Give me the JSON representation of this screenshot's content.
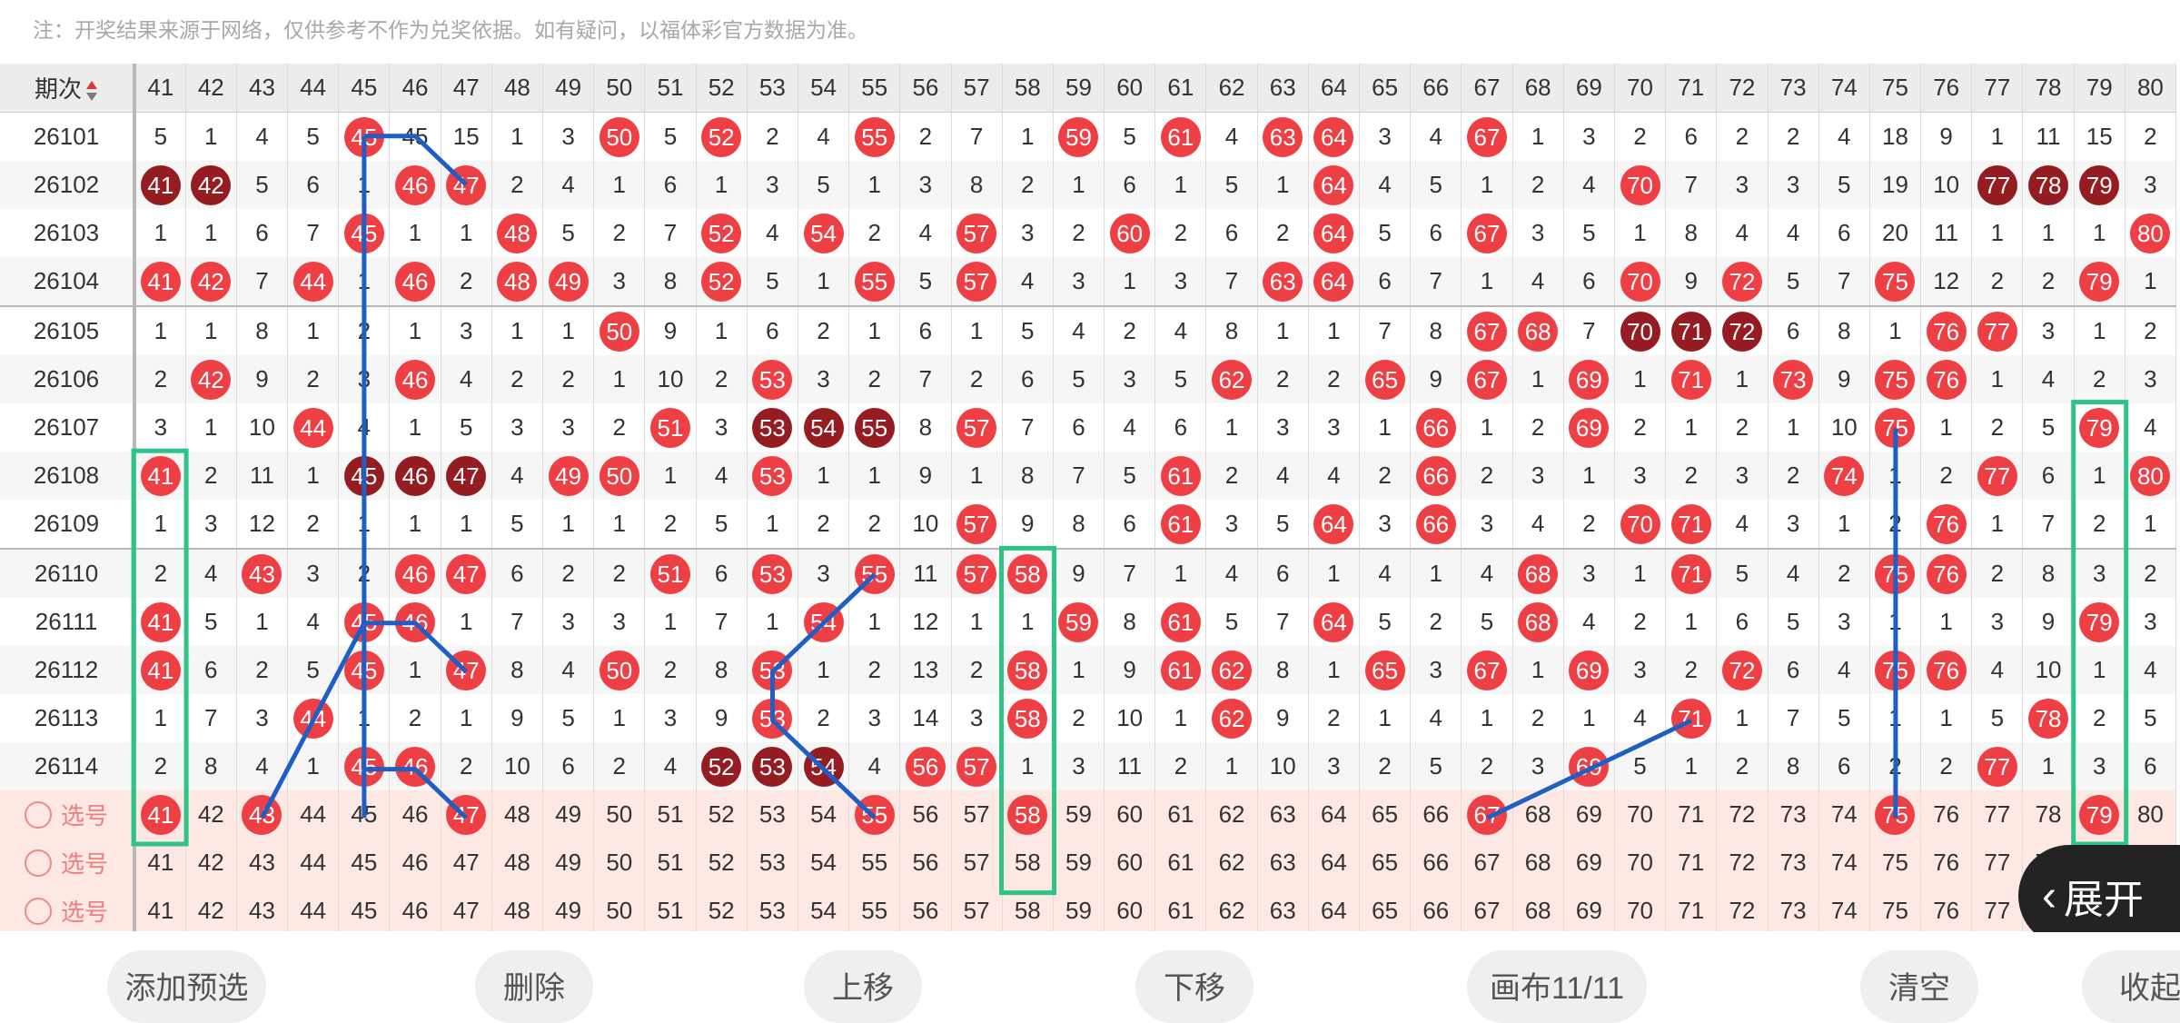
{
  "notice": "注：开奖结果来源于网络，仅供参考不作为兑奖依据。如有疑问，以福体彩官方数据为准。",
  "header": {
    "period_label": "期次",
    "numbers": [
      41,
      42,
      43,
      44,
      45,
      46,
      47,
      48,
      49,
      50,
      51,
      52,
      53,
      54,
      55,
      56,
      57,
      58,
      59,
      60,
      61,
      62,
      63,
      64,
      65,
      66,
      67,
      68,
      69,
      70,
      71,
      72,
      73,
      74,
      75,
      76,
      77,
      78,
      79,
      80
    ]
  },
  "rows": [
    {
      "period": "26101",
      "cells": [
        "5",
        "1",
        "4",
        "5",
        "45",
        "45",
        "15",
        "1",
        "3",
        "50",
        "5",
        "52",
        "2",
        "4",
        "55",
        "2",
        "7",
        "1",
        "59",
        "5",
        "61",
        "4",
        "63",
        "64",
        "3",
        "4",
        "67",
        "1",
        "3",
        "2",
        "6",
        "2",
        "2",
        "4",
        "18",
        "9",
        "1",
        "11",
        "15",
        "2"
      ]
    },
    {
      "period": "26102",
      "cells": [
        "41",
        "42",
        "5",
        "6",
        "1",
        "46",
        "47",
        "2",
        "4",
        "1",
        "6",
        "1",
        "3",
        "5",
        "1",
        "3",
        "8",
        "2",
        "1",
        "6",
        "1",
        "5",
        "1",
        "64",
        "4",
        "5",
        "1",
        "2",
        "4",
        "70",
        "7",
        "3",
        "3",
        "5",
        "19",
        "10",
        "77",
        "78",
        "79",
        "3"
      ]
    },
    {
      "period": "26103",
      "cells": [
        "1",
        "1",
        "6",
        "7",
        "45",
        "1",
        "1",
        "48",
        "5",
        "2",
        "7",
        "52",
        "4",
        "54",
        "2",
        "4",
        "57",
        "3",
        "2",
        "60",
        "2",
        "6",
        "2",
        "64",
        "5",
        "6",
        "67",
        "3",
        "5",
        "1",
        "8",
        "4",
        "4",
        "6",
        "20",
        "11",
        "1",
        "1",
        "1",
        "80"
      ]
    },
    {
      "period": "26104",
      "cells": [
        "41",
        "42",
        "7",
        "44",
        "1",
        "46",
        "2",
        "48",
        "49",
        "3",
        "8",
        "52",
        "5",
        "1",
        "55",
        "5",
        "57",
        "4",
        "3",
        "1",
        "3",
        "7",
        "63",
        "64",
        "6",
        "7",
        "1",
        "4",
        "6",
        "70",
        "9",
        "72",
        "5",
        "7",
        "75",
        "12",
        "2",
        "2",
        "79",
        "1"
      ]
    },
    {
      "period": "26105",
      "cells": [
        "1",
        "1",
        "8",
        "1",
        "2",
        "1",
        "3",
        "1",
        "1",
        "50",
        "9",
        "1",
        "6",
        "2",
        "1",
        "6",
        "1",
        "5",
        "4",
        "2",
        "4",
        "8",
        "1",
        "1",
        "7",
        "8",
        "67",
        "68",
        "7",
        "70",
        "71",
        "72",
        "6",
        "8",
        "1",
        "76",
        "77",
        "3",
        "1",
        "2"
      ]
    },
    {
      "period": "26106",
      "cells": [
        "2",
        "42",
        "9",
        "2",
        "3",
        "46",
        "4",
        "2",
        "2",
        "1",
        "10",
        "2",
        "53",
        "3",
        "2",
        "7",
        "2",
        "6",
        "5",
        "3",
        "5",
        "62",
        "2",
        "2",
        "65",
        "9",
        "67",
        "1",
        "69",
        "1",
        "71",
        "1",
        "73",
        "9",
        "75",
        "76",
        "1",
        "4",
        "2",
        "3"
      ]
    },
    {
      "period": "26107",
      "cells": [
        "3",
        "1",
        "10",
        "44",
        "4",
        "1",
        "5",
        "3",
        "3",
        "2",
        "51",
        "3",
        "53",
        "54",
        "55",
        "8",
        "57",
        "7",
        "6",
        "4",
        "6",
        "1",
        "3",
        "3",
        "1",
        "66",
        "1",
        "2",
        "69",
        "2",
        "1",
        "2",
        "1",
        "10",
        "75",
        "1",
        "2",
        "5",
        "79",
        "4"
      ]
    },
    {
      "period": "26108",
      "cells": [
        "41",
        "2",
        "11",
        "1",
        "45",
        "46",
        "47",
        "4",
        "49",
        "50",
        "1",
        "4",
        "53",
        "1",
        "1",
        "9",
        "1",
        "8",
        "7",
        "5",
        "61",
        "2",
        "4",
        "4",
        "2",
        "66",
        "2",
        "3",
        "1",
        "3",
        "2",
        "3",
        "2",
        "74",
        "1",
        "2",
        "77",
        "6",
        "1",
        "80"
      ]
    },
    {
      "period": "26109",
      "cells": [
        "1",
        "3",
        "12",
        "2",
        "1",
        "1",
        "1",
        "5",
        "1",
        "1",
        "2",
        "5",
        "1",
        "2",
        "2",
        "10",
        "57",
        "9",
        "8",
        "6",
        "61",
        "3",
        "5",
        "64",
        "3",
        "66",
        "3",
        "4",
        "2",
        "70",
        "71",
        "4",
        "3",
        "1",
        "2",
        "76",
        "1",
        "7",
        "2",
        "1"
      ]
    },
    {
      "period": "26110",
      "cells": [
        "2",
        "4",
        "43",
        "3",
        "2",
        "46",
        "47",
        "6",
        "2",
        "2",
        "51",
        "6",
        "53",
        "3",
        "55",
        "11",
        "57",
        "58",
        "9",
        "7",
        "1",
        "4",
        "6",
        "1",
        "4",
        "1",
        "4",
        "68",
        "3",
        "1",
        "71",
        "5",
        "4",
        "2",
        "75",
        "76",
        "2",
        "8",
        "3",
        "2"
      ]
    },
    {
      "period": "26111",
      "cells": [
        "41",
        "5",
        "1",
        "4",
        "45",
        "46",
        "1",
        "7",
        "3",
        "3",
        "1",
        "7",
        "1",
        "54",
        "1",
        "12",
        "1",
        "1",
        "59",
        "8",
        "61",
        "5",
        "7",
        "64",
        "5",
        "2",
        "5",
        "68",
        "4",
        "2",
        "1",
        "6",
        "5",
        "3",
        "1",
        "1",
        "3",
        "9",
        "79",
        "3"
      ]
    },
    {
      "period": "26112",
      "cells": [
        "41",
        "6",
        "2",
        "5",
        "45",
        "1",
        "47",
        "8",
        "4",
        "50",
        "2",
        "8",
        "53",
        "1",
        "2",
        "13",
        "2",
        "58",
        "1",
        "9",
        "61",
        "62",
        "8",
        "1",
        "65",
        "3",
        "67",
        "1",
        "69",
        "3",
        "2",
        "72",
        "6",
        "4",
        "75",
        "76",
        "4",
        "10",
        "1",
        "4"
      ]
    },
    {
      "period": "26113",
      "cells": [
        "1",
        "7",
        "3",
        "44",
        "1",
        "2",
        "1",
        "9",
        "5",
        "1",
        "3",
        "9",
        "53",
        "2",
        "3",
        "14",
        "3",
        "58",
        "2",
        "10",
        "1",
        "62",
        "9",
        "2",
        "1",
        "4",
        "1",
        "2",
        "1",
        "4",
        "71",
        "1",
        "7",
        "5",
        "1",
        "1",
        "5",
        "78",
        "2",
        "5"
      ]
    },
    {
      "period": "26114",
      "cells": [
        "2",
        "8",
        "4",
        "1",
        "45",
        "46",
        "2",
        "10",
        "6",
        "2",
        "4",
        "52",
        "53",
        "54",
        "4",
        "56",
        "57",
        "1",
        "3",
        "11",
        "2",
        "1",
        "10",
        "3",
        "2",
        "5",
        "2",
        "3",
        "69",
        "5",
        "1",
        "2",
        "8",
        "6",
        "2",
        "2",
        "77",
        "1",
        "3",
        "6"
      ]
    }
  ],
  "dark_cells": [
    "26102:41",
    "26102:42",
    "26102:77",
    "26102:78",
    "26102:79",
    "26105:70",
    "26105:71",
    "26105:72",
    "26107:53",
    "26107:54",
    "26107:55",
    "26108:45",
    "26108:46",
    "26108:47",
    "26114:52",
    "26114:53",
    "26114:54"
  ],
  "selection_rows": [
    {
      "label": "选号",
      "picked": [
        41,
        43,
        47,
        55,
        58,
        67,
        75,
        79
      ]
    },
    {
      "label": "选号",
      "picked": []
    },
    {
      "label": "选号",
      "picked": []
    }
  ],
  "expand_button": {
    "label": "展开"
  },
  "bottom_buttons": [
    "添加预选",
    "删除",
    "上移",
    "下移",
    "画布11/11",
    "清空",
    "收起"
  ],
  "colors": {
    "ball": "#ee3f45",
    "ball_dark": "#951d22",
    "line": "#1f5fc4",
    "box": "#2ec488",
    "selection_row_bg": "#fde8e4"
  }
}
